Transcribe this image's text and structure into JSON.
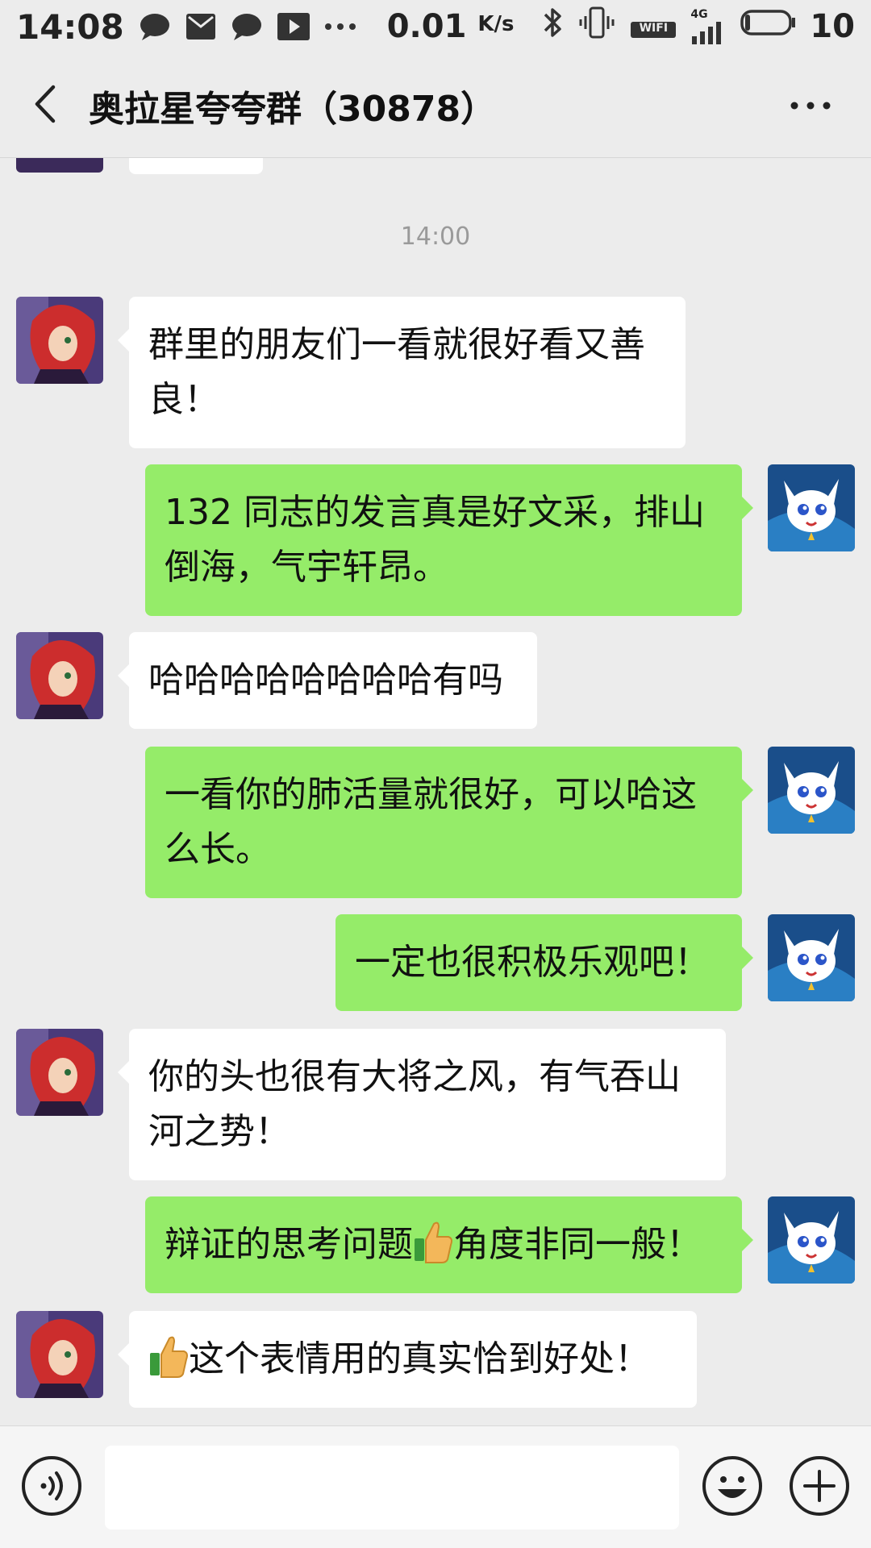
{
  "status_bar": {
    "time": "14:08",
    "speed": "0.01",
    "speed_unit": "K/s",
    "network_label": "4G",
    "wifi_label": "WIFI",
    "battery": "10"
  },
  "header": {
    "title": "奥拉星夸夸群（30878）"
  },
  "chat": {
    "timestamp": "14:00",
    "messages": [
      {
        "side": "left",
        "text": "群里的朋友们一看就很好看又善良！"
      },
      {
        "side": "right",
        "text": "132 同志的发言真是好文采，排山倒海，气宇轩昂。"
      },
      {
        "side": "left",
        "text": "哈哈哈哈哈哈哈哈有吗"
      },
      {
        "side": "right",
        "text": "一看你的肺活量就很好，可以哈这么长。"
      },
      {
        "side": "right",
        "text": "一定也很积极乐观吧！"
      },
      {
        "side": "left",
        "text": "你的头也很有大将之风，有气吞山河之势！"
      },
      {
        "side": "right",
        "text_before": "辩证的思考问题",
        "text_after": "角度非同一般！"
      },
      {
        "side": "left",
        "text_before": "",
        "text_after": "这个表情用的真实恰到好处！"
      }
    ]
  },
  "colors": {
    "background": "#ececec",
    "bubble_self": "#95ec69",
    "bubble_other": "#ffffff"
  },
  "icons": [
    "chat-bubble-icon",
    "mail-icon",
    "chat-bubble-icon",
    "play-icon",
    "more-dots-icon",
    "bluetooth-icon",
    "vibrate-icon",
    "wifi-icon",
    "signal-icon",
    "battery-icon",
    "back-arrow-icon",
    "more-icon",
    "voice-icon",
    "emoji-icon",
    "plus-icon",
    "thumbs-up-emoji"
  ]
}
